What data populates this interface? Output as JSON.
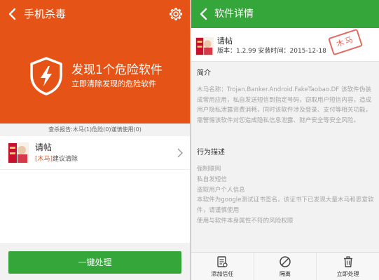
{
  "left": {
    "title": "手机杀毒",
    "alert_title": "发现1个危险软件",
    "alert_subtitle": "立即清除发现的危险软件",
    "report_bar": "查杀报告:木马(1)危险(0)谨慎使用(0)",
    "app": {
      "name": "请帖",
      "tag": "[木马]",
      "status": "建议清除"
    },
    "one_key_button": "一键处理",
    "colors": {
      "header_bg": "#e65316",
      "button_bg": "#35a63a",
      "tag": "#e65316"
    }
  },
  "right": {
    "title": "软件详情",
    "app": {
      "name": "请帖",
      "meta": "版本：1.2.99  安装时间：2015-12-18",
      "stamp": "木马"
    },
    "intro_title": "简介",
    "intro_text": "木马名称：Trojan.Banker.Android.FakeTaobao.DF 该软件伪装成常用应用，私自发送短信到指定号码，窃取用户短信内容，造成用户隐私泄露资费消耗，同时该软件涉及登录、支付等相关功能，需警惕该软件对您造成隐私信息泄露、财产安全等安全风险。",
    "behavior_title": "行为描述",
    "behaviors": [
      "强制联网",
      "私自发短信",
      "盗取用户个人信息",
      "本软件为google测试证书签名，该证书下已发现大量木马和恶意软件，请谨慎使用",
      "使用与软件本身属性不符的风险权限"
    ],
    "actions": [
      {
        "label": "添加信任",
        "icon": "document-trust-icon"
      },
      {
        "label": "隔离",
        "icon": "block-icon"
      },
      {
        "label": "立即处理",
        "icon": "trash-icon"
      }
    ],
    "colors": {
      "titlebar_bg": "#35a63a",
      "stamp": "#e36a5f"
    }
  }
}
